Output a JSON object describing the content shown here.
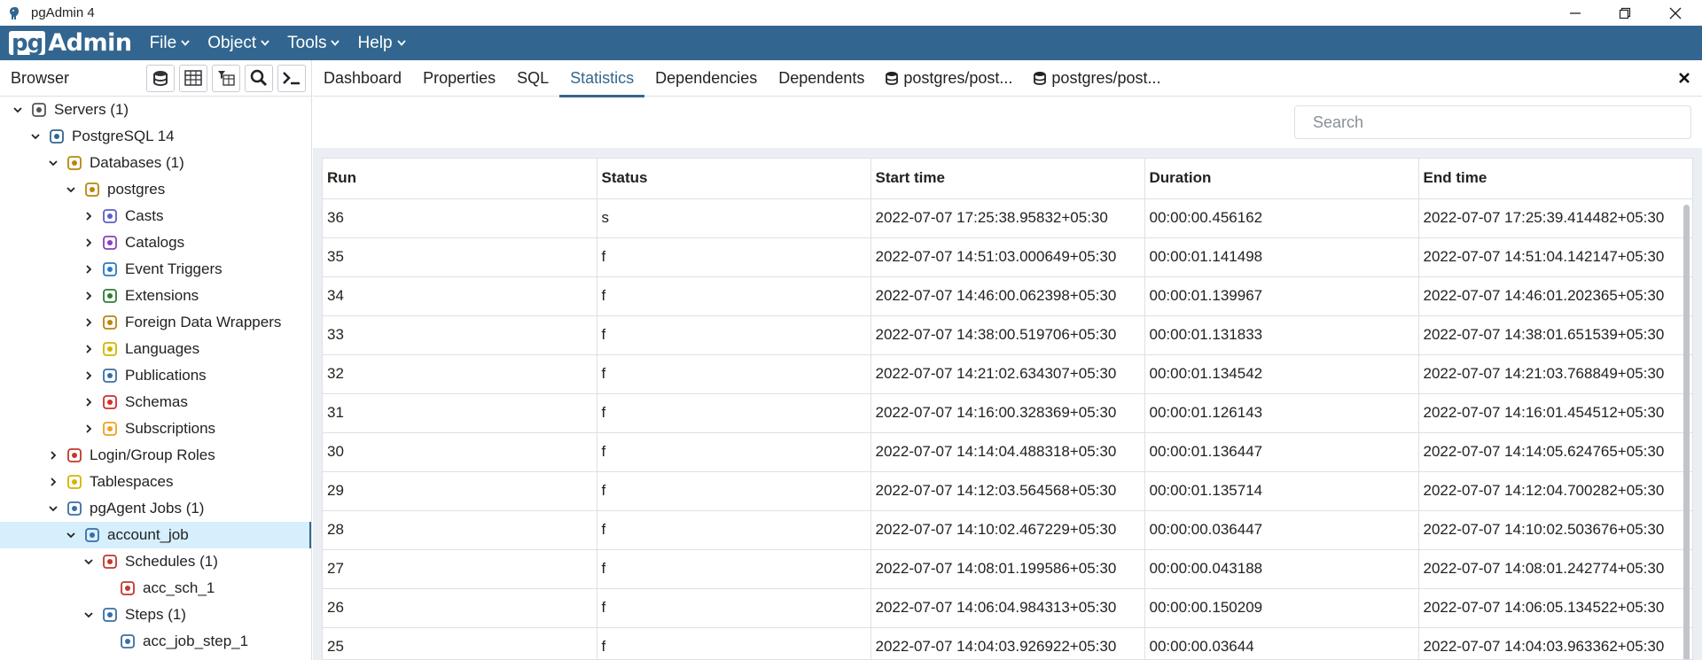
{
  "window": {
    "title": "pgAdmin 4"
  },
  "menubar": {
    "logo_pg": "pg",
    "logo_admin": "Admin",
    "items": [
      {
        "label": "File"
      },
      {
        "label": "Object"
      },
      {
        "label": "Tools"
      },
      {
        "label": "Help"
      }
    ]
  },
  "browser": {
    "title": "Browser",
    "toolbar_icons": [
      "database-query-icon",
      "table-view-icon",
      "filtered-rows-icon",
      "search-icon",
      "terminal-icon"
    ],
    "tree": [
      {
        "label": "Servers (1)",
        "icon": "servers-icon",
        "expanded": true
      },
      {
        "label": "PostgreSQL 14",
        "icon": "elephant-icon",
        "expanded": true
      },
      {
        "label": "Databases (1)",
        "icon": "databases-icon",
        "expanded": true
      },
      {
        "label": "postgres",
        "icon": "database-icon",
        "expanded": true
      },
      {
        "label": "Casts",
        "icon": "casts-icon",
        "expanded": false
      },
      {
        "label": "Catalogs",
        "icon": "catalogs-icon",
        "expanded": false
      },
      {
        "label": "Event Triggers",
        "icon": "event-triggers-icon",
        "expanded": false
      },
      {
        "label": "Extensions",
        "icon": "extensions-icon",
        "expanded": false
      },
      {
        "label": "Foreign Data Wrappers",
        "icon": "fdw-icon",
        "expanded": false
      },
      {
        "label": "Languages",
        "icon": "languages-icon",
        "expanded": false
      },
      {
        "label": "Publications",
        "icon": "publications-icon",
        "expanded": false
      },
      {
        "label": "Schemas",
        "icon": "schemas-icon",
        "expanded": false
      },
      {
        "label": "Subscriptions",
        "icon": "subscriptions-icon",
        "expanded": false
      },
      {
        "label": "Login/Group Roles",
        "icon": "roles-icon",
        "expanded": false
      },
      {
        "label": "Tablespaces",
        "icon": "tablespaces-icon",
        "expanded": false
      },
      {
        "label": "pgAgent Jobs (1)",
        "icon": "jobs-icon",
        "expanded": true
      },
      {
        "label": "account_job",
        "icon": "job-icon",
        "expanded": true,
        "selected": true
      },
      {
        "label": "Schedules (1)",
        "icon": "schedules-icon",
        "expanded": true
      },
      {
        "label": "acc_sch_1",
        "icon": "schedule-icon"
      },
      {
        "label": "Steps (1)",
        "icon": "steps-icon",
        "expanded": true
      },
      {
        "label": "acc_job_step_1",
        "icon": "step-icon"
      }
    ]
  },
  "tabs": [
    {
      "label": "Dashboard"
    },
    {
      "label": "Properties"
    },
    {
      "label": "SQL"
    },
    {
      "label": "Statistics",
      "active": true
    },
    {
      "label": "Dependencies"
    },
    {
      "label": "Dependents"
    },
    {
      "label": "postgres/post...",
      "icon": "query-tool-icon"
    },
    {
      "label": "postgres/post...",
      "icon": "query-tool-icon"
    }
  ],
  "search": {
    "placeholder": "Search"
  },
  "table": {
    "columns": [
      "Run",
      "Status",
      "Start time",
      "Duration",
      "End time"
    ],
    "rows": [
      [
        "36",
        "s",
        "2022-07-07 17:25:38.95832+05:30",
        "00:00:00.456162",
        "2022-07-07 17:25:39.414482+05:30"
      ],
      [
        "35",
        "f",
        "2022-07-07 14:51:03.000649+05:30",
        "00:00:01.141498",
        "2022-07-07 14:51:04.142147+05:30"
      ],
      [
        "34",
        "f",
        "2022-07-07 14:46:00.062398+05:30",
        "00:00:01.139967",
        "2022-07-07 14:46:01.202365+05:30"
      ],
      [
        "33",
        "f",
        "2022-07-07 14:38:00.519706+05:30",
        "00:00:01.131833",
        "2022-07-07 14:38:01.651539+05:30"
      ],
      [
        "32",
        "f",
        "2022-07-07 14:21:02.634307+05:30",
        "00:00:01.134542",
        "2022-07-07 14:21:03.768849+05:30"
      ],
      [
        "31",
        "f",
        "2022-07-07 14:16:00.328369+05:30",
        "00:00:01.126143",
        "2022-07-07 14:16:01.454512+05:30"
      ],
      [
        "30",
        "f",
        "2022-07-07 14:14:04.488318+05:30",
        "00:00:01.136447",
        "2022-07-07 14:14:05.624765+05:30"
      ],
      [
        "29",
        "f",
        "2022-07-07 14:12:03.564568+05:30",
        "00:00:01.135714",
        "2022-07-07 14:12:04.700282+05:30"
      ],
      [
        "28",
        "f",
        "2022-07-07 14:10:02.467229+05:30",
        "00:00:00.036447",
        "2022-07-07 14:10:02.503676+05:30"
      ],
      [
        "27",
        "f",
        "2022-07-07 14:08:01.199586+05:30",
        "00:00:00.043188",
        "2022-07-07 14:08:01.242774+05:30"
      ],
      [
        "26",
        "f",
        "2022-07-07 14:06:04.984313+05:30",
        "00:00:00.150209",
        "2022-07-07 14:06:05.134522+05:30"
      ],
      [
        "25",
        "f",
        "2022-07-07 14:04:03.926922+05:30",
        "00:00:00.03644",
        "2022-07-07 14:04:03.963362+05:30"
      ]
    ]
  },
  "colors": {
    "brand": "#326690",
    "selected_row": "#d6effc",
    "panel_bg": "#ebeef3"
  }
}
